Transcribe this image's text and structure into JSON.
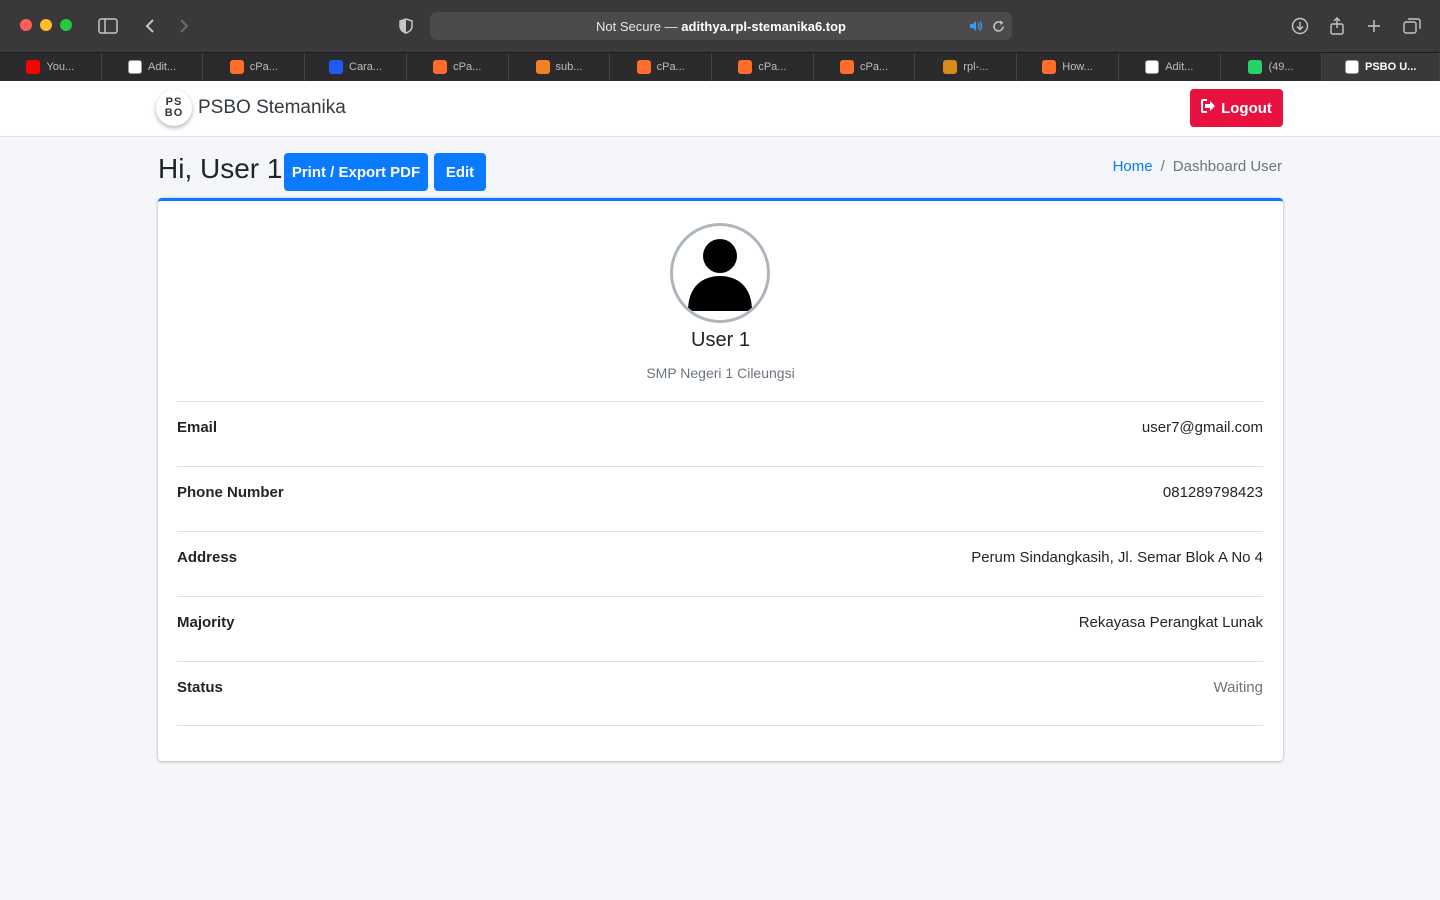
{
  "browser": {
    "url_prefix": "Not Secure —",
    "url_domain": "adithya.rpl-stemanika6.top",
    "tabs": [
      {
        "label": "You...",
        "favicon": "youtube-icon",
        "color": "#ff0000"
      },
      {
        "label": "Adit...",
        "favicon": "github-icon",
        "color": "#ffffff"
      },
      {
        "label": "cPa...",
        "favicon": "cpanel-icon",
        "color": "#ff6c2c"
      },
      {
        "label": "Cara...",
        "favicon": "blue-app-icon",
        "color": "#1c5bf5"
      },
      {
        "label": "cPa...",
        "favicon": "cpanel-icon",
        "color": "#ff6c2c"
      },
      {
        "label": "sub...",
        "favicon": "stackoverflow-icon",
        "color": "#f48024"
      },
      {
        "label": "cPa...",
        "favicon": "cpanel-icon",
        "color": "#ff6c2c"
      },
      {
        "label": "cPa...",
        "favicon": "cpanel-icon",
        "color": "#ff6c2c"
      },
      {
        "label": "cPa...",
        "favicon": "cpanel-icon",
        "color": "#ff6c2c"
      },
      {
        "label": "rpl-...",
        "favicon": "rpl-logo-icon",
        "color": "#d98a1c"
      },
      {
        "label": "How...",
        "favicon": "cpanel-icon",
        "color": "#ff6c2c"
      },
      {
        "label": "Adit...",
        "favicon": "github-icon",
        "color": "#ffffff"
      },
      {
        "label": "(49...",
        "favicon": "whatsapp-icon",
        "color": "#25d366"
      },
      {
        "label": "PSBO U...",
        "favicon": "psbo-icon",
        "color": "#ffffff",
        "active": true
      }
    ]
  },
  "navbar": {
    "logo_top": "PS",
    "logo_bottom": "BO",
    "brand": "PSBO Stemanika",
    "logout_label": "Logout"
  },
  "header": {
    "greeting": "Hi, User 1",
    "print_label": "Print / Export PDF",
    "edit_label": "Edit",
    "breadcrumb_home": "Home",
    "breadcrumb_sep": "/",
    "breadcrumb_current": "Dashboard User"
  },
  "profile": {
    "name": "User 1",
    "school": "SMP Negeri 1 Cileungsi",
    "rows": [
      {
        "label": "Email",
        "value": "user7@gmail.com"
      },
      {
        "label": "Phone Number",
        "value": "081289798423"
      },
      {
        "label": "Address",
        "value": "Perum Sindangkasih, Jl. Semar Blok A No 4"
      },
      {
        "label": "Majority",
        "value": "Rekayasa Perangkat Lunak"
      },
      {
        "label": "Status",
        "value": "Waiting"
      }
    ]
  },
  "colors": {
    "primary": "#0a7bff",
    "danger": "#e8113f",
    "background": "#f4f6f9"
  }
}
